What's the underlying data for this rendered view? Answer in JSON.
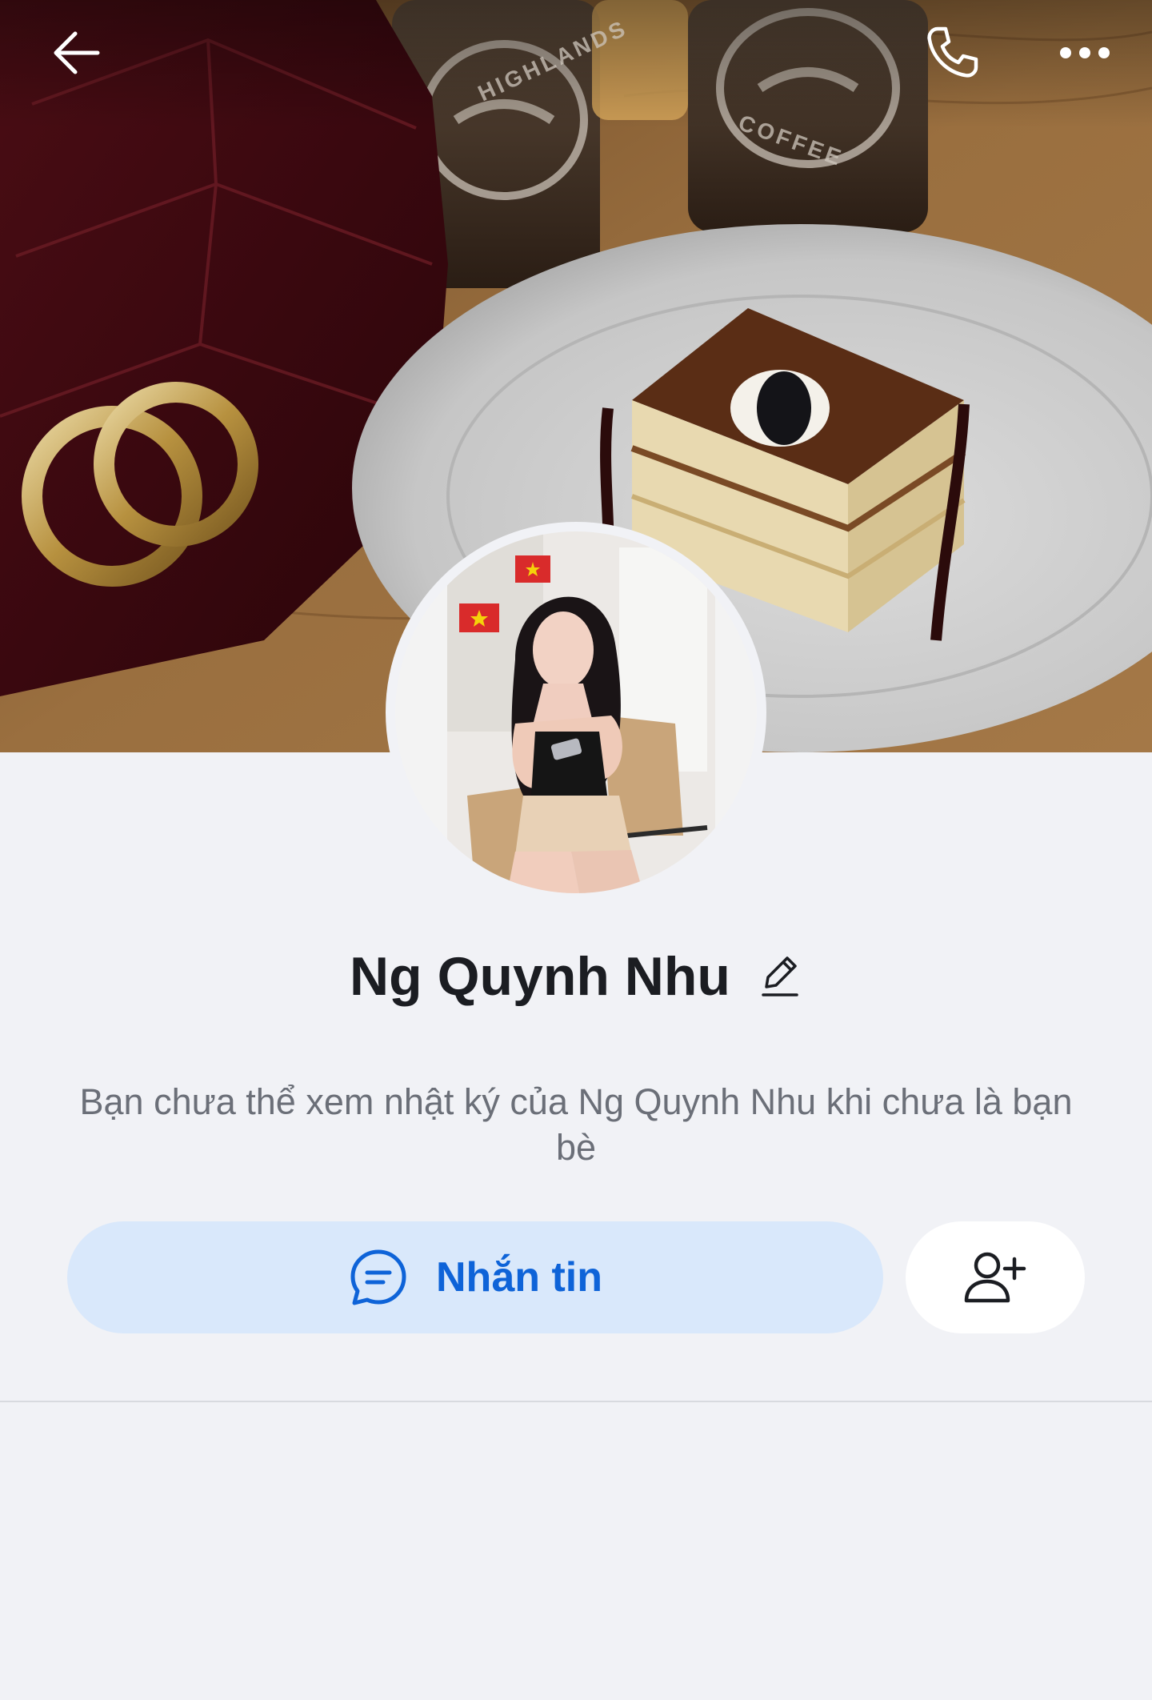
{
  "profile": {
    "name": "Ng Quynh Nhu",
    "notice": "Bạn chưa thể xem nhật ký của Ng Quynh Nhu khi chưa là bạn bè"
  },
  "actions": {
    "message_label": "Nhắn tin"
  },
  "cover": {
    "cup_text_top": "HIGHLANDS",
    "cup_text_bottom": "COFFEE"
  },
  "icons": {
    "back": "back-arrow-icon",
    "call": "phone-icon",
    "more": "more-dots-icon",
    "edit": "pencil-icon",
    "message": "chat-bubble-icon",
    "add_friend": "add-friend-icon"
  },
  "colors": {
    "accent": "#0e63d8",
    "message_button_bg": "#d9e8fb",
    "background": "#f1f2f6",
    "text_primary": "#1b1d22",
    "text_secondary": "#6b6f78"
  }
}
